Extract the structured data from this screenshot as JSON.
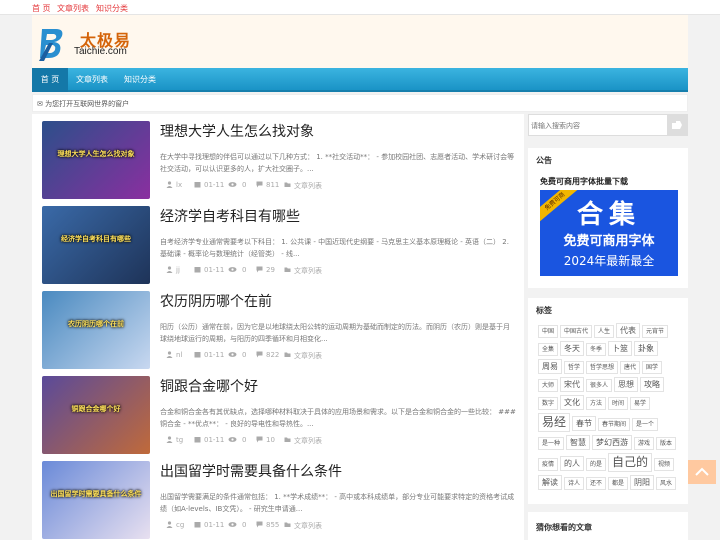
{
  "topbar": {
    "links": [
      "首 页",
      "文章列表",
      "知识分类"
    ]
  },
  "logo": {
    "cn": "太极易",
    "en": "Taichie.com"
  },
  "nav": {
    "items": [
      "首 页",
      "文章列表",
      "知识分类"
    ]
  },
  "notice": {
    "text": "✉ 为您打开互联网世界的窗户"
  },
  "posts": [
    {
      "title": "理想大学人生怎么找对象",
      "thumb_label": "理想大学人生怎么找对象",
      "excerpt": "在大学中寻找理想的伴侣可以通过以下几种方式： 1. **社交活动**： - 参加校园社团、志愿者活动、学术研讨会等社交活动，可以认识更多的人，扩大社交圈子。...",
      "author": "lx",
      "date": "01-11",
      "views": "0",
      "id": "811",
      "category": "文章列表",
      "colors": [
        "#2c4f8a",
        "#8a2fa0"
      ]
    },
    {
      "title": "经济学自考科目有哪些",
      "thumb_label": "经济学自考科目有哪些",
      "excerpt": "自考经济学专业通常需要考以下科目： 1. 公共课 - 中国近现代史纲要 - 马克思主义基本原理概论 - 英语（二） 2. 基础课 - 概率论与数理统计（经管类） - 线...",
      "author": "jj",
      "date": "01-11",
      "views": "0",
      "id": "29",
      "category": "文章列表",
      "colors": [
        "#3a6aa8",
        "#1e3358"
      ]
    },
    {
      "title": "农历阴历哪个在前",
      "thumb_label": "农历阴历哪个在前",
      "excerpt": "阳历（公历）通常在前，因为它是以地球绕太阳公转的运动周期为基础而制定的历法。而阴历（农历）则是基于月球绕地球运行的周期，与阳历的四季循环和月相变化...",
      "author": "nl",
      "date": "01-11",
      "views": "0",
      "id": "822",
      "category": "文章列表",
      "colors": [
        "#4a8ac0",
        "#c8d8f0"
      ]
    },
    {
      "title": "铜跟合金哪个好",
      "thumb_label": "铜跟合金哪个好",
      "excerpt": "合金和铜合金各有其优缺点，选择哪种材料取决于具体的应用场景和需求。以下是合金和铜合金的一些比较： ### 铜合金 - **优点**： - 良好的导电性和导热性。...",
      "author": "tg",
      "date": "01-11",
      "views": "0",
      "id": "10",
      "category": "文章列表",
      "colors": [
        "#5a4a9a",
        "#c06a3a"
      ]
    },
    {
      "title": "出国留学时需要具备什么条件",
      "thumb_label": "出国留学时需要具备什么条件",
      "excerpt": "出国留学需要满足的条件通常包括： 1. **学术成绩**： - 高中或本科成绩单，部分专业可能要求特定的资格考试成绩（如A-levels、IB文凭）。 - 研究生申请通...",
      "author": "cg",
      "date": "01-11",
      "views": "0",
      "id": "855",
      "category": "文章列表",
      "colors": [
        "#6a8ad8",
        "#e8e0f0"
      ]
    }
  ],
  "sidebar": {
    "search_placeholder": "请输入搜索内容",
    "announce": {
      "heading": "公告",
      "title": "免费可商用字体批量下载",
      "banner_big": "合集",
      "banner_line1": "免费可商用字体",
      "banner_line2": "2024年最新最全",
      "banner_ribbon": "免费可商"
    },
    "tags_heading": "标签",
    "tags": [
      {
        "t": "中国",
        "s": "s"
      },
      {
        "t": "中国古代",
        "s": "s"
      },
      {
        "t": "人生",
        "s": "s"
      },
      {
        "t": "代表",
        "s": "m"
      },
      {
        "t": "元宵节",
        "s": "s"
      },
      {
        "t": "全集",
        "s": "s"
      },
      {
        "t": "冬天",
        "s": "m"
      },
      {
        "t": "冬季",
        "s": "s"
      },
      {
        "t": "卜筮",
        "s": "m"
      },
      {
        "t": "卦象",
        "s": "m"
      },
      {
        "t": "周易",
        "s": "m"
      },
      {
        "t": "哲学",
        "s": "s"
      },
      {
        "t": "哲学思想",
        "s": "s"
      },
      {
        "t": "唐代",
        "s": "s"
      },
      {
        "t": "国学",
        "s": "s"
      },
      {
        "t": "大师",
        "s": "s"
      },
      {
        "t": "宋代",
        "s": "m"
      },
      {
        "t": "很多人",
        "s": "s"
      },
      {
        "t": "思想",
        "s": "m"
      },
      {
        "t": "攻略",
        "s": "m"
      },
      {
        "t": "数字",
        "s": "s"
      },
      {
        "t": "文化",
        "s": "m"
      },
      {
        "t": "方法",
        "s": "s"
      },
      {
        "t": "时间",
        "s": "s"
      },
      {
        "t": "易学",
        "s": "s"
      },
      {
        "t": "易经",
        "s": "l"
      },
      {
        "t": "春节",
        "s": "m"
      },
      {
        "t": "春节期间",
        "s": "s"
      },
      {
        "t": "是一个",
        "s": "s"
      },
      {
        "t": "是一种",
        "s": "s"
      },
      {
        "t": "智慧",
        "s": "m"
      },
      {
        "t": "梦幻西游",
        "s": "m"
      },
      {
        "t": "游戏",
        "s": "s"
      },
      {
        "t": "版本",
        "s": "s"
      },
      {
        "t": "疫情",
        "s": "s"
      },
      {
        "t": "的人",
        "s": "m"
      },
      {
        "t": "的是",
        "s": "s"
      },
      {
        "t": "自己的",
        "s": "l"
      },
      {
        "t": "视频",
        "s": "s"
      },
      {
        "t": "解读",
        "s": "m"
      },
      {
        "t": "诗人",
        "s": "s"
      },
      {
        "t": "还不",
        "s": "s"
      },
      {
        "t": "都是",
        "s": "s"
      },
      {
        "t": "阴阳",
        "s": "m"
      },
      {
        "t": "风水",
        "s": "s"
      }
    ],
    "guess_heading": "猜你想看的文章"
  },
  "colors": {
    "accent": "#e4393c",
    "nav": "#1a93c6",
    "logo_text": "#d4640a"
  }
}
